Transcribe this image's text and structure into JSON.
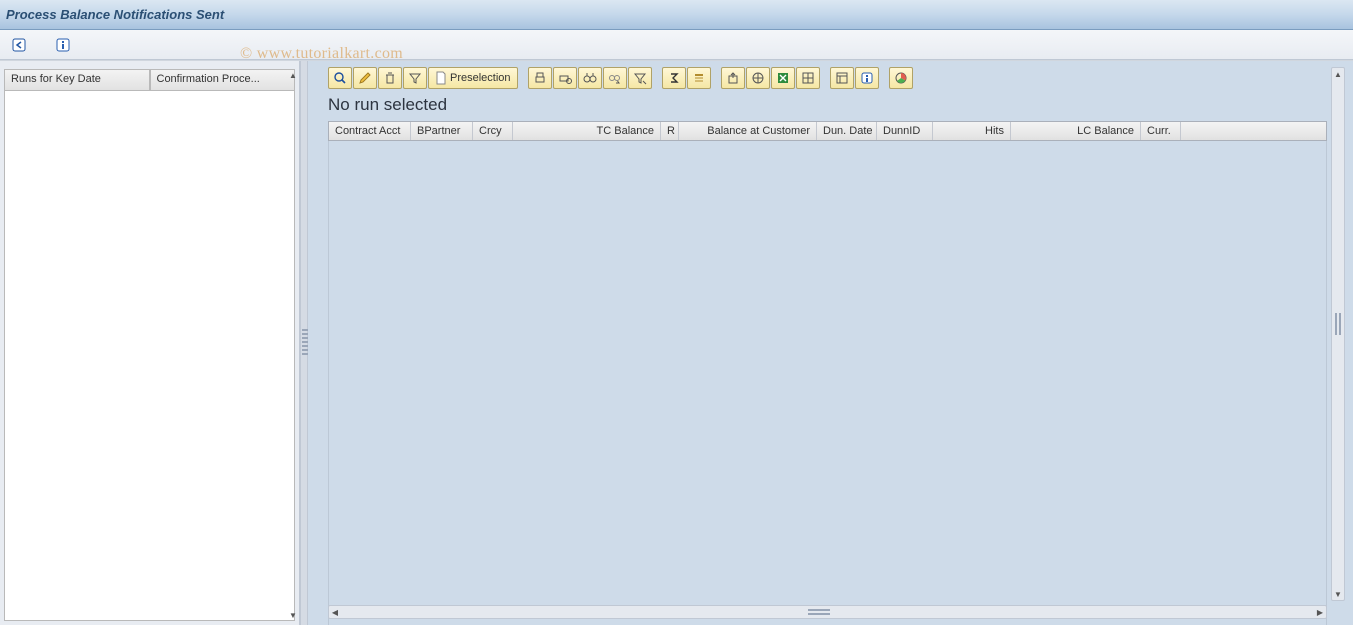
{
  "title": "Process Balance Notifications Sent",
  "watermark": "© www.tutorialkart.com",
  "app_toolbar": {
    "back": "back-icon",
    "info": "info-icon"
  },
  "left_panel": {
    "columns": [
      {
        "label": "Runs for Key Date"
      },
      {
        "label": "Confirmation Proce..."
      }
    ]
  },
  "grid_toolbar": {
    "preselection_label": "Preselection"
  },
  "message": "No run selected",
  "grid_columns": [
    {
      "label": "Contract Acct",
      "w": 82,
      "align": "left"
    },
    {
      "label": "BPartner",
      "w": 62,
      "align": "left"
    },
    {
      "label": "Crcy",
      "w": 40,
      "align": "left"
    },
    {
      "label": "TC Balance",
      "w": 148,
      "align": "right"
    },
    {
      "label": "R",
      "w": 18,
      "align": "left"
    },
    {
      "label": "Balance at Customer",
      "w": 138,
      "align": "right"
    },
    {
      "label": "Dun. Date",
      "w": 60,
      "align": "left"
    },
    {
      "label": "DunnID",
      "w": 56,
      "align": "left"
    },
    {
      "label": "Hits",
      "w": 78,
      "align": "right"
    },
    {
      "label": "LC Balance",
      "w": 130,
      "align": "right"
    },
    {
      "label": "Curr.",
      "w": 40,
      "align": "left"
    }
  ]
}
